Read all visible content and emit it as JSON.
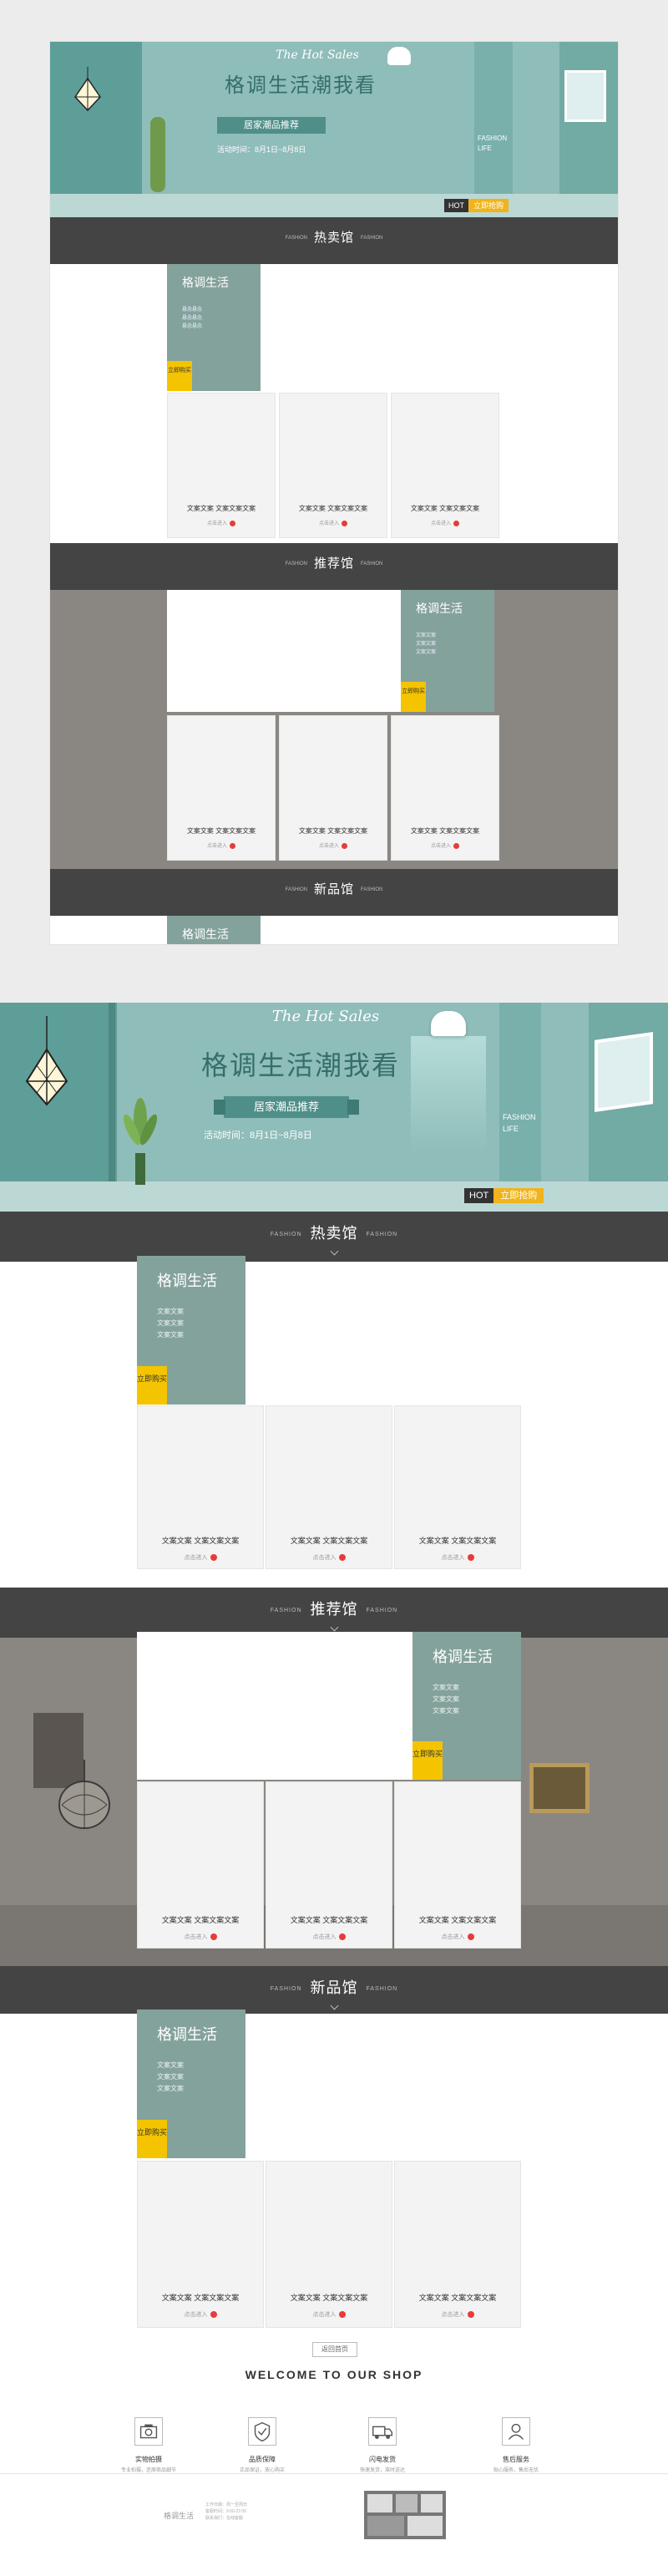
{
  "colors": {
    "accent_teal": "#84a29c",
    "bar_dark": "#444444",
    "buy_yellow": "#f5c400",
    "dot_red": "#e83b3b"
  },
  "banner": {
    "script": "The Hot Sales",
    "title": "格调生活潮我看",
    "ribbon": "居家潮品推荐",
    "date": "活动时间：8月1日~8月8日",
    "fashion_line1": "FASHION",
    "fashion_line2": "LIFE",
    "hot_tag": "HOT",
    "hot_button": "立即抢购"
  },
  "sections": {
    "hot": "热卖馆",
    "recommend": "推荐馆",
    "new": "新品馆",
    "side_text": "FASHION"
  },
  "feature": {
    "title": "格调生活",
    "lines": [
      "文案文案",
      "文案文案",
      "文案文案"
    ],
    "buy": "立即购买"
  },
  "card": {
    "title": "文案文案 文案文案文案",
    "sub": "点击进入"
  },
  "preview_feature": {
    "lines": [
      "悬念悬念",
      "悬念悬念",
      "悬念悬念"
    ]
  },
  "more_button": "返回首页",
  "welcome": "WELCOME TO OUR SHOP",
  "services": [
    {
      "name": "实物拍摄",
      "desc": "专业拍摄，还原商品细节"
    },
    {
      "name": "品质保障",
      "desc": "正品保证，放心购买"
    },
    {
      "name": "闪电发货",
      "desc": "快速发货，准时送达"
    },
    {
      "name": "售后服务",
      "desc": "贴心服务，售后无忧"
    }
  ],
  "footer": {
    "shop_name": "格调生活",
    "info": [
      "工作日期：周一至周日",
      "客服时间：9:00-22:00",
      "联系我们：在线客服"
    ]
  }
}
